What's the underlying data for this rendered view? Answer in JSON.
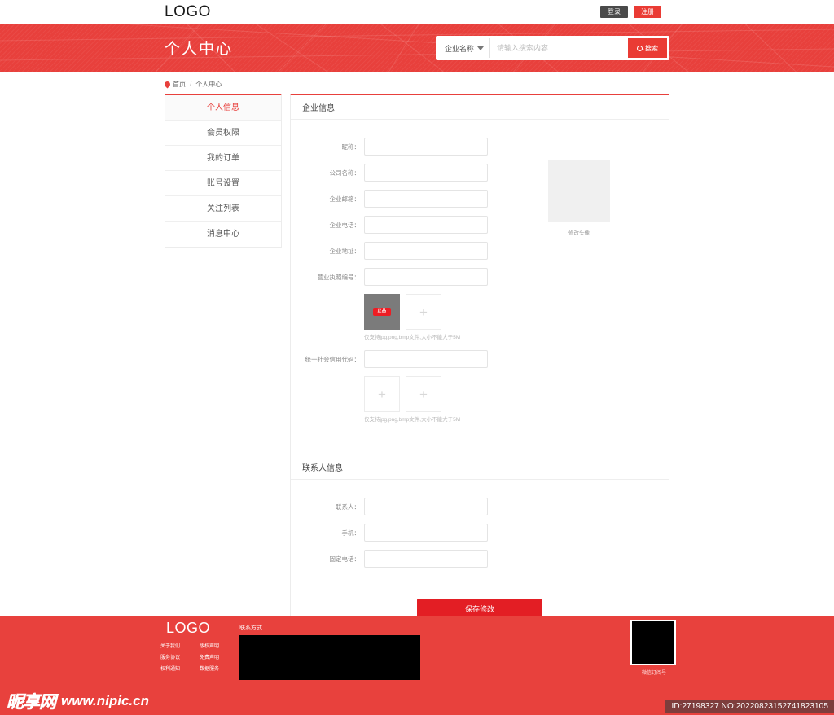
{
  "colors": {
    "brand_red": "#e8403c",
    "button_red": "#e31e24",
    "register_red": "#ea3b34",
    "login_gray": "#4a4a4a",
    "footer_red": "#e8413d"
  },
  "topbar": {
    "logo": "LOGO",
    "login_label": "登录",
    "register_label": "注册"
  },
  "banner": {
    "title": "个人中心"
  },
  "search": {
    "category": "企业名称",
    "placeholder": "请输入搜索内容",
    "value": "",
    "button_label": "搜索"
  },
  "breadcrumb": {
    "home": "首页",
    "separator": "/",
    "current": "个人中心"
  },
  "sidebar": {
    "items": [
      {
        "label": "个人信息",
        "active": true
      },
      {
        "label": "会员权限",
        "active": false
      },
      {
        "label": "我的订单",
        "active": false
      },
      {
        "label": "账号设置",
        "active": false
      },
      {
        "label": "关注列表",
        "active": false
      },
      {
        "label": "消息中心",
        "active": false
      }
    ]
  },
  "company_section": {
    "title": "企业信息",
    "fields": [
      {
        "label": "昵称：",
        "value": "",
        "placeholder": ""
      },
      {
        "label": "公司名称：",
        "value": "",
        "placeholder": ""
      },
      {
        "label": "企业邮箱：",
        "value": "",
        "placeholder": ""
      },
      {
        "label": "企业电话：",
        "value": "",
        "placeholder": ""
      },
      {
        "label": "企业地址：",
        "value": "",
        "placeholder": ""
      },
      {
        "label": "营业执照编号：",
        "value": "",
        "placeholder": ""
      }
    ],
    "license_upload": {
      "hint": "仅支持jpg,png,bmp文件,大小不能大于5M",
      "thumb_badge": "正品",
      "add_label": "+"
    },
    "credit_code": {
      "label": "统一社会信用代码：",
      "value": "",
      "placeholder": ""
    },
    "credit_upload": {
      "hint": "仅支持jpg,png,bmp文件,大小不能大于5M",
      "add_label": "+"
    },
    "avatar": {
      "caption": "修改头像"
    }
  },
  "contact_section": {
    "title": "联系人信息",
    "fields": [
      {
        "label": "联系人：",
        "value": "",
        "placeholder": ""
      },
      {
        "label": "手机：",
        "value": "",
        "placeholder": ""
      },
      {
        "label": "固定电话：",
        "value": "",
        "placeholder": ""
      }
    ]
  },
  "save_button": {
    "label": "保存修改"
  },
  "footer": {
    "logo": "LOGO",
    "links": [
      "关于我们",
      "版权声明",
      "服务协议",
      "免费声明",
      "权利通知",
      "数据服务"
    ],
    "contact_title": "联系方式",
    "qr_caption": "微信订阅号"
  },
  "watermark": {
    "cn": "昵享网",
    "url": "www.nipic.cn",
    "id_badge": "ID:27198327 NO:20220823152741823105"
  }
}
